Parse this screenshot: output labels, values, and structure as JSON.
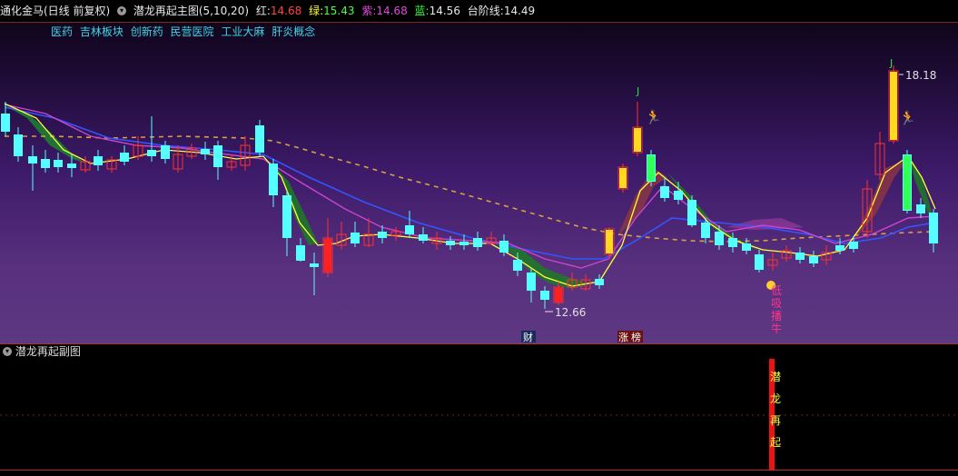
{
  "header": {
    "stock": "通化金马(日线 前复权)",
    "indicator": "潜龙再起主图(5,10,20)",
    "red_label": "红:",
    "red_value": "14.68",
    "green_label": "绿:",
    "green_value": "15.43",
    "purple_label": "紫:",
    "purple_value": "14.68",
    "blue_label": "蓝:",
    "blue_value": "14.56",
    "step_label": "台阶线:",
    "step_value": "14.49"
  },
  "concepts": [
    "医药",
    "吉林板块",
    "创新药",
    "民营医院",
    "工业大麻",
    "肝炎概念"
  ],
  "annotations": {
    "high": "18.18",
    "low": "12.66",
    "j1": "J",
    "j2": "J",
    "cai": "财",
    "zhang": "涨",
    "bang": "榜",
    "vertical": [
      "低",
      "吸",
      "播",
      "牛"
    ]
  },
  "sub": {
    "title": "潜龙再起副图",
    "signal": [
      "潜",
      "龙",
      "再",
      "起"
    ]
  },
  "colors": {
    "up": "#ff3030",
    "down": "#55ffff",
    "ma5": "#ffff40",
    "ma10": "#cc44cc",
    "ma20": "#4466ff",
    "step": "#d9a040"
  }
}
